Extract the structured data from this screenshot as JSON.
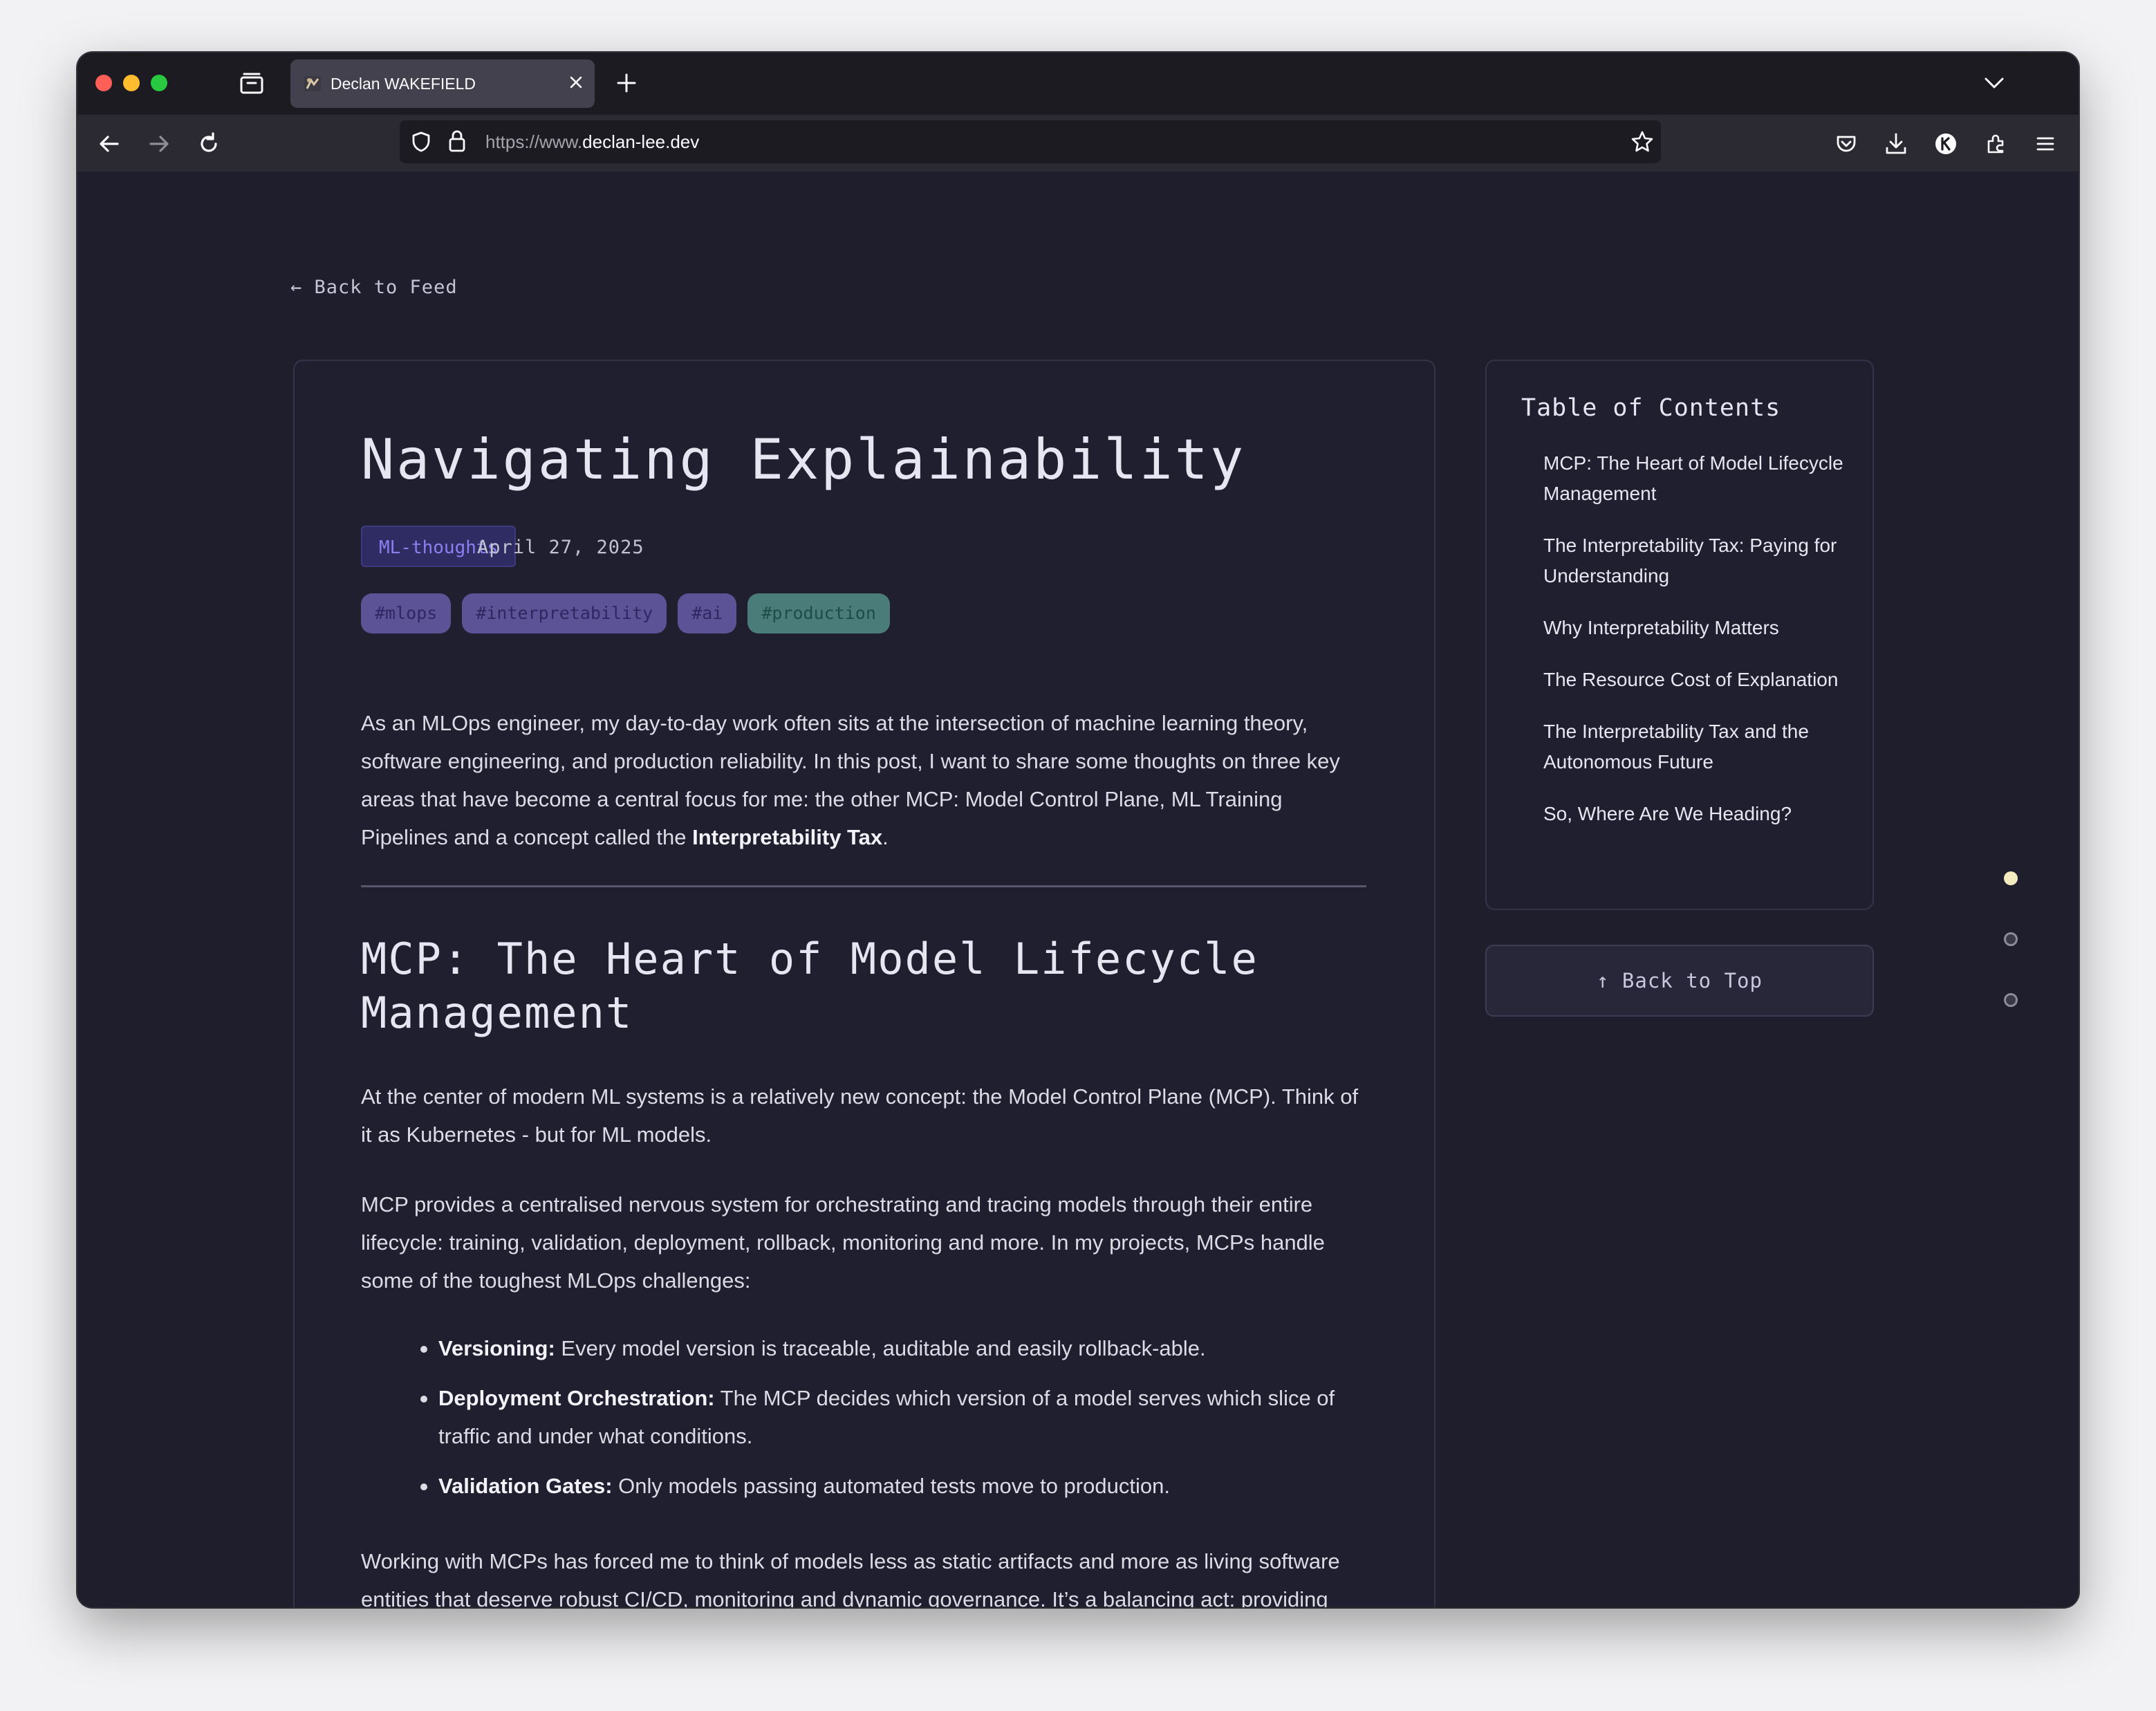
{
  "browser": {
    "tab_title": "Declan WAKEFIELD",
    "url_prefix": "https://www.",
    "url_domain": "declan-lee.dev"
  },
  "page": {
    "back_to_feed": "← Back to Feed",
    "title": "Navigating Explainability",
    "category": "ML-thoughts",
    "date": "April 27, 2025",
    "tags": [
      {
        "label": "#mlops",
        "color": "#5b5396"
      },
      {
        "label": "#interpretability",
        "color": "#5b5396"
      },
      {
        "label": "#ai",
        "color": "#5b5396"
      },
      {
        "label": "#production",
        "color": "#4a7d7a"
      }
    ],
    "intro_text": "As an MLOps engineer, my day-to-day work often sits at the intersection of machine learning theory, software engineering, and production reliability. In this post, I want to share some thoughts on three key areas that have become a central focus for me: the other MCP: Model Control Plane, ML Training Pipelines and a concept called the ",
    "intro_bold": "Interpretability Tax",
    "intro_end": ".",
    "section1_heading": "MCP: The Heart of Model Lifecycle Management",
    "section1_p1": "At the center of modern ML systems is a relatively new concept: the Model Control Plane (MCP). Think of it as Kubernetes - but for ML models.",
    "section1_p2": "MCP provides a centralised nervous system for orchestrating and tracing models through their entire lifecycle: training, validation, deployment, rollback, monitoring and more. In my projects, MCPs handle some of the toughest MLOps challenges:",
    "bullets": [
      {
        "bold": "Versioning:",
        "text": " Every model version is traceable, auditable and easily rollback-able."
      },
      {
        "bold": "Deployment Orchestration:",
        "text": " The MCP decides which version of a model serves which slice of traffic and under what conditions."
      },
      {
        "bold": "Validation Gates:",
        "text": " Only models passing automated tests move to production."
      }
    ],
    "section1_p3": "Working with MCPs has forced me to think of models less as static artifacts and more as living software entities that deserve robust CI/CD, monitoring and dynamic governance. It’s a balancing act: providing enough flexibility for researchers while ensuring reliability and compliance in production."
  },
  "toc": {
    "title": "Table of Contents",
    "items": [
      "MCP: The Heart of Model Lifecycle Management",
      "The Interpretability Tax: Paying for Understanding",
      "Why Interpretability Matters",
      "The Resource Cost of Explanation",
      "The Interpretability Tax and the Autonomous Future",
      "So, Where Are We Heading?"
    ],
    "back_to_top": "↑ Back to Top"
  }
}
